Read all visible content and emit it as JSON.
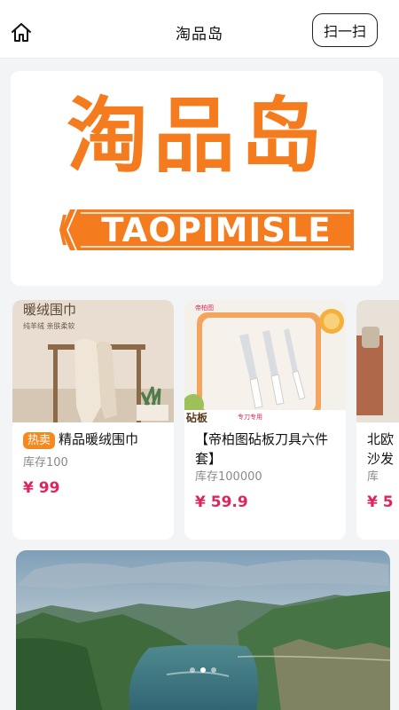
{
  "header": {
    "title": "淘品岛",
    "scan_label": "扫一扫",
    "home_icon": "home-icon"
  },
  "logo": {
    "text_cn": "淘品岛",
    "text_en": "TAOPIMISLE",
    "brand_color": "#f47b1e"
  },
  "products": [
    {
      "tag": "热卖",
      "name": "精品暖绒围巾",
      "stock": "库存100",
      "price": "¥ 99",
      "image_text_title": "暖绒围巾",
      "image_text_sub": "纯羊绒  亲肤柔软"
    },
    {
      "tag": "",
      "name": "【帝柏图砧板刀具六件套】",
      "stock": "库存100000",
      "price": "¥ 59.9",
      "image_text_title": "砧板",
      "image_text_sub": "专刀专用"
    },
    {
      "tag": "",
      "name": "北欧沙发",
      "stock": "库",
      "price": "¥ 5"
    }
  ],
  "banner": {
    "slide_count": 3,
    "active_index": 1
  },
  "colors": {
    "accent": "#f47b1e",
    "price": "#e0245e",
    "tag": "#f5891f"
  }
}
